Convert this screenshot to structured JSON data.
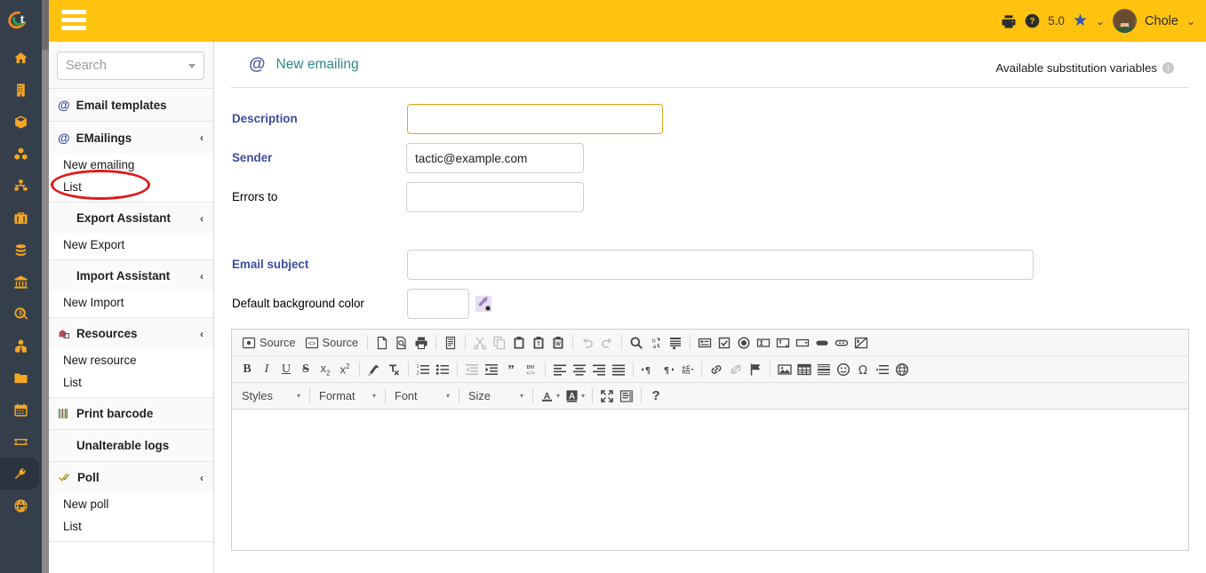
{
  "brand": {
    "logo_letter": "t",
    "accent_orange": "#ef8327",
    "accent_green": "#2e9c4a",
    "topbar_color": "#ffc20e",
    "rail_color": "#343f4b",
    "icon_color": "#f5a623"
  },
  "topbar": {
    "menu_toggle": "menu-hamburger",
    "print_icon": "print-icon",
    "help_icon": "help-circle-icon",
    "version": "5.0",
    "favorites_icon": "star-icon",
    "favorites_caret": "⌄",
    "user_name": "Chole",
    "user_caret": "⌄"
  },
  "rail": {
    "items": [
      {
        "name": "home-icon",
        "label": "Home",
        "active": false
      },
      {
        "name": "building-icon",
        "label": "Companies",
        "active": false
      },
      {
        "name": "box-icon",
        "label": "Products",
        "active": false
      },
      {
        "name": "cubes-icon",
        "label": "Stock",
        "active": false
      },
      {
        "name": "sitemap-icon",
        "label": "Projects",
        "active": false
      },
      {
        "name": "briefcase-icon",
        "label": "Commercial",
        "active": false
      },
      {
        "name": "coins-icon",
        "label": "Billing",
        "active": false
      },
      {
        "name": "bank-icon",
        "label": "Bank",
        "active": false
      },
      {
        "name": "search-dollar-icon",
        "label": "Accounting",
        "active": false
      },
      {
        "name": "user-tie-icon",
        "label": "HRM",
        "active": false
      },
      {
        "name": "folder-icon",
        "label": "Documents",
        "active": false
      },
      {
        "name": "calendar-icon",
        "label": "Agenda",
        "active": false
      },
      {
        "name": "ticket-icon",
        "label": "Tickets",
        "active": false
      },
      {
        "name": "wrench-icon",
        "label": "Tools",
        "active": true
      },
      {
        "name": "globe-icon",
        "label": "Website",
        "active": false
      }
    ]
  },
  "sidebar": {
    "search_placeholder": "Search",
    "search_value": "",
    "groups": [
      {
        "id": "email-templates",
        "icon": "at-icon",
        "label": "Email templates",
        "collapsible": false,
        "chevron": "",
        "items": []
      },
      {
        "id": "emailings",
        "icon": "at-icon",
        "label": "EMailings",
        "collapsible": true,
        "chevron": "‹",
        "items": [
          {
            "label": "New emailing",
            "highlighted": true
          },
          {
            "label": "List",
            "highlighted": false
          }
        ]
      },
      {
        "id": "export-assistant",
        "icon": "gears-icon",
        "label": "Export Assistant",
        "collapsible": true,
        "chevron": "‹",
        "items": [
          {
            "label": "New Export",
            "highlighted": false
          }
        ]
      },
      {
        "id": "import-assistant",
        "icon": "gears-icon",
        "label": "Import Assistant",
        "collapsible": true,
        "chevron": "‹",
        "items": [
          {
            "label": "New Import",
            "highlighted": false
          }
        ]
      },
      {
        "id": "resources",
        "icon": "resource-icon",
        "label": "Resources",
        "collapsible": true,
        "chevron": "‹",
        "items": [
          {
            "label": "New resource",
            "highlighted": false
          },
          {
            "label": "List",
            "highlighted": false
          }
        ]
      },
      {
        "id": "print-barcode",
        "icon": "barcode-icon",
        "label": "Print barcode",
        "collapsible": false,
        "chevron": "",
        "items": []
      },
      {
        "id": "unalterable-logs",
        "icon": "gears-icon",
        "label": "Unalterable logs",
        "collapsible": false,
        "chevron": "",
        "items": []
      },
      {
        "id": "poll",
        "icon": "poll-check-icon",
        "label": "Poll",
        "collapsible": true,
        "chevron": "‹",
        "items": [
          {
            "label": "New poll",
            "highlighted": false
          },
          {
            "label": "List",
            "highlighted": false
          }
        ]
      }
    ]
  },
  "annotation": {
    "shape": "ellipse",
    "color": "#e01b1b",
    "target": "New emailing"
  },
  "page": {
    "icon": "at-icon",
    "title": "New emailing",
    "substitution_link": "Available substitution variables",
    "info_glyph": "i"
  },
  "form": {
    "fields": [
      {
        "id": "description",
        "label": "Description",
        "required": true,
        "value": "",
        "placeholder": "",
        "focused": true
      },
      {
        "id": "sender",
        "label": "Sender",
        "required": true,
        "value": "tactic@example.com",
        "placeholder": "",
        "focused": false
      },
      {
        "id": "errors_to",
        "label": "Errors to",
        "required": false,
        "value": "",
        "placeholder": "",
        "focused": false
      },
      {
        "id": "email_subject",
        "label": "Email subject",
        "required": true,
        "value": "",
        "placeholder": "",
        "focused": false
      },
      {
        "id": "default_background_color",
        "label": "Default background color",
        "required": false,
        "value": "",
        "placeholder": "",
        "focused": false,
        "picker_icon": "eyedropper-icon"
      }
    ]
  },
  "editor": {
    "toolbar_row1": [
      {
        "name": "source-button",
        "label": "Source",
        "icon": "source-icon",
        "disabled": false,
        "type": "text"
      },
      {
        "name": "source-alt-button",
        "label": "Source",
        "icon": "source-code-icon",
        "disabled": false,
        "type": "text"
      },
      {
        "name": "separator",
        "type": "sep"
      },
      {
        "name": "new-page-icon",
        "label": "New Page",
        "disabled": false,
        "type": "icon"
      },
      {
        "name": "preview-icon",
        "label": "Preview",
        "disabled": false,
        "type": "icon"
      },
      {
        "name": "print-icon",
        "label": "Print",
        "disabled": false,
        "type": "icon"
      },
      {
        "name": "separator",
        "type": "sep"
      },
      {
        "name": "templates-icon",
        "label": "Templates",
        "disabled": false,
        "type": "icon"
      },
      {
        "name": "separator",
        "type": "sep"
      },
      {
        "name": "cut-icon",
        "label": "Cut",
        "disabled": true,
        "type": "icon"
      },
      {
        "name": "copy-icon",
        "label": "Copy",
        "disabled": true,
        "type": "icon"
      },
      {
        "name": "paste-icon",
        "label": "Paste",
        "disabled": false,
        "type": "icon"
      },
      {
        "name": "paste-as-text-icon",
        "label": "Paste as plain text",
        "disabled": false,
        "type": "icon"
      },
      {
        "name": "paste-from-word-icon",
        "label": "Paste from Word",
        "disabled": false,
        "type": "icon"
      },
      {
        "name": "separator",
        "type": "sep"
      },
      {
        "name": "undo-icon",
        "label": "Undo",
        "disabled": true,
        "type": "icon"
      },
      {
        "name": "redo-icon",
        "label": "Redo",
        "disabled": true,
        "type": "icon"
      },
      {
        "name": "separator",
        "type": "sep"
      },
      {
        "name": "find-icon",
        "label": "Find",
        "disabled": false,
        "type": "icon"
      },
      {
        "name": "replace-icon",
        "label": "Replace",
        "disabled": false,
        "type": "icon"
      },
      {
        "name": "select-all-icon",
        "label": "Select All",
        "disabled": false,
        "type": "icon"
      },
      {
        "name": "separator",
        "type": "sep"
      },
      {
        "name": "form-icon",
        "label": "Form",
        "disabled": false,
        "type": "icon"
      },
      {
        "name": "checkbox-icon",
        "label": "Checkbox",
        "disabled": false,
        "type": "icon"
      },
      {
        "name": "radio-button-icon",
        "label": "Radio Button",
        "disabled": false,
        "type": "icon"
      },
      {
        "name": "text-field-icon",
        "label": "Text Field",
        "disabled": false,
        "type": "icon"
      },
      {
        "name": "textarea-icon",
        "label": "Textarea",
        "disabled": false,
        "type": "icon"
      },
      {
        "name": "selection-field-icon",
        "label": "Selection Field",
        "disabled": false,
        "type": "icon"
      },
      {
        "name": "button-icon",
        "label": "Button",
        "disabled": false,
        "type": "icon"
      },
      {
        "name": "image-button-icon",
        "label": "Image Button",
        "disabled": false,
        "type": "icon"
      },
      {
        "name": "hidden-field-icon",
        "label": "Hidden Field",
        "disabled": false,
        "type": "icon"
      }
    ],
    "toolbar_row2": [
      {
        "name": "bold-button",
        "label": "B",
        "disabled": false
      },
      {
        "name": "italic-button",
        "label": "I",
        "disabled": false
      },
      {
        "name": "underline-button",
        "label": "U",
        "disabled": false
      },
      {
        "name": "strikethrough-button",
        "label": "S",
        "disabled": false
      },
      {
        "name": "subscript-button",
        "label": "x₂",
        "disabled": false
      },
      {
        "name": "superscript-button",
        "label": "x²",
        "disabled": false
      },
      {
        "name": "copy-formatting-icon",
        "label": "Copy Formatting",
        "disabled": false
      },
      {
        "name": "remove-format-icon",
        "label": "Remove Format",
        "disabled": false
      },
      {
        "name": "numbered-list-icon",
        "label": "Insert/Remove Numbered List",
        "disabled": false
      },
      {
        "name": "bulleted-list-icon",
        "label": "Insert/Remove Bulleted List",
        "disabled": false
      },
      {
        "name": "decrease-indent-icon",
        "label": "Decrease Indent",
        "disabled": true
      },
      {
        "name": "increase-indent-icon",
        "label": "Increase Indent",
        "disabled": false
      },
      {
        "name": "blockquote-icon",
        "label": "Block Quote",
        "disabled": false
      },
      {
        "name": "div-container-icon",
        "label": "Create Div Container",
        "disabled": false
      },
      {
        "name": "align-left-icon",
        "label": "Align Left",
        "disabled": false
      },
      {
        "name": "align-center-icon",
        "label": "Center",
        "disabled": false
      },
      {
        "name": "align-right-icon",
        "label": "Align Right",
        "disabled": false
      },
      {
        "name": "justify-icon",
        "label": "Justify",
        "disabled": false
      },
      {
        "name": "ltr-icon",
        "label": "Text direction from left to right",
        "disabled": false
      },
      {
        "name": "rtl-icon",
        "label": "Text direction from right to left",
        "disabled": false
      },
      {
        "name": "language-icon",
        "label": "Set Language",
        "disabled": false
      },
      {
        "name": "link-icon",
        "label": "Link",
        "disabled": false
      },
      {
        "name": "unlink-icon",
        "label": "Unlink",
        "disabled": true
      },
      {
        "name": "anchor-icon",
        "label": "Anchor",
        "disabled": false
      },
      {
        "name": "image-icon",
        "label": "Image",
        "disabled": false
      },
      {
        "name": "table-icon",
        "label": "Table",
        "disabled": false
      },
      {
        "name": "horizontal-rule-icon",
        "label": "Insert Horizontal Line",
        "disabled": false
      },
      {
        "name": "smiley-icon",
        "label": "Smiley",
        "disabled": false
      },
      {
        "name": "special-character-icon",
        "label": "Insert Special Character",
        "disabled": false
      },
      {
        "name": "page-break-icon",
        "label": "Insert Page Break for Printing",
        "disabled": false
      },
      {
        "name": "iframe-icon",
        "label": "IFrame",
        "disabled": false
      }
    ],
    "toolbar_row3": {
      "styles_label": "Styles",
      "format_label": "Format",
      "font_label": "Font",
      "size_label": "Size",
      "text_color_label": "Text Color",
      "bg_color_label": "Background Color",
      "maximize_label": "Maximize",
      "show_blocks_label": "Show Blocks",
      "about_label": "?"
    },
    "body_content": ""
  }
}
